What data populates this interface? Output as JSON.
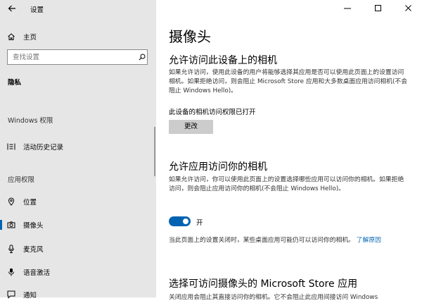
{
  "window": {
    "title": "设置"
  },
  "sidebar": {
    "home": "主页",
    "search_placeholder": "查找设置",
    "category": "隐私",
    "section_windows": "Windows 权限",
    "activity_history": "活动历史记录",
    "section_app": "应用权限",
    "items": [
      {
        "label": "位置",
        "icon": "location-icon"
      },
      {
        "label": "摄像头",
        "icon": "camera-icon",
        "selected": true
      },
      {
        "label": "麦克风",
        "icon": "microphone-icon"
      },
      {
        "label": "语音激活",
        "icon": "voice-activation-icon"
      },
      {
        "label": "通知",
        "icon": "notification-icon"
      }
    ]
  },
  "main": {
    "title": "摄像头",
    "device_section": {
      "heading": "允许访问此设备上的相机",
      "description": "如果允许访问，使用此设备的用户将能够选择其应用是否可以使用此页面上的设置访问相机。如果拒绝访问，则会阻止 Microsoft Store 应用和大多数桌面应用访问相机(不会阻止 Windows Hello)。",
      "status": "此设备的相机访问权限已打开",
      "change_button": "更改"
    },
    "app_section": {
      "heading": "允许应用访问你的相机",
      "description": "如果允许访问，你可以使用此页面上的设置选择哪些应用可以访问你的相机。如果拒绝访问，则会阻止应用访问你的相机(不会阻止 Windows Hello)。",
      "toggle_state": "开",
      "toggle_on": true,
      "note": "当此页面上的设置关闭时，某些桌面应用可能仍可以访问你的相机。",
      "learn_more": "了解原因"
    },
    "store_section": {
      "heading": "选择可访问摄像头的 Microsoft Store 应用",
      "description": "关闭应用会阻止其直接访问你的相机。它不会阻止此应用间接访问 Windows"
    }
  },
  "colors": {
    "accent": "#0063b1",
    "sidebar_bg": "#e6e6e6",
    "button_bg": "#cccccc"
  }
}
